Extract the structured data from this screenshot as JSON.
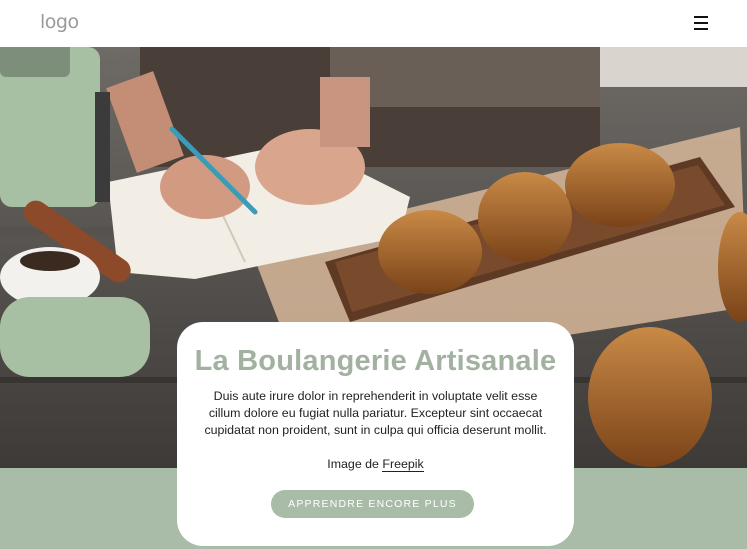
{
  "header": {
    "logo_text": "logo",
    "menu_icon": "hamburger-menu-icon"
  },
  "hero_image": {
    "subject": "croissants-on-wooden-board-with-notebook-and-coffee-machine"
  },
  "card": {
    "title": "La Boulangerie Artisanale",
    "text": "Duis aute irure dolor in reprehenderit in voluptate velit esse cillum dolore eu fugiat nulla pariatur. Excepteur sint occaecat cupidatat non proident, sunt in culpa qui officia deserunt mollit.",
    "credit_prefix": "Image de ",
    "credit_link": "Freepik",
    "button_label": "APPRENDRE ENCORE PLUS"
  },
  "colors": {
    "accent": "#a9bca8",
    "title": "#a2b1a0",
    "text": "#222222",
    "background": "#ffffff"
  }
}
